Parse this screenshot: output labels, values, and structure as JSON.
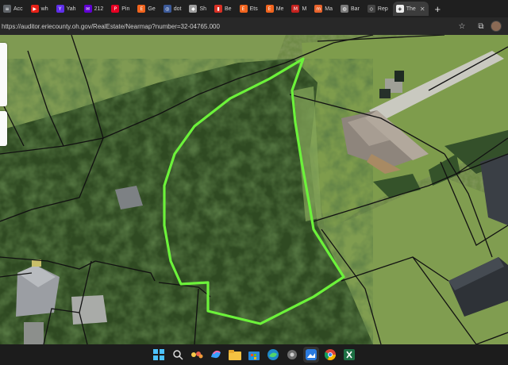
{
  "browser": {
    "tabs": [
      {
        "label": "Acc",
        "icon": "document-icon",
        "color": "#5f6368"
      },
      {
        "label": "wh",
        "icon": "youtube-icon",
        "color": "#e62117"
      },
      {
        "label": "Yah",
        "icon": "yahoo-icon",
        "color": "#5f2eea"
      },
      {
        "label": "212",
        "icon": "yahoo-mail-icon",
        "color": "#6001d2"
      },
      {
        "label": "Pin",
        "icon": "pinterest-icon",
        "color": "#e60023"
      },
      {
        "label": "Ge",
        "icon": "etsy-icon",
        "color": "#f1641e"
      },
      {
        "label": "dot",
        "icon": "circle-logo-icon",
        "color": "#3b5998"
      },
      {
        "label": "Sh",
        "icon": "shopping-icon",
        "color": "#9e9e9e"
      },
      {
        "label": "Be",
        "icon": "bookmark-icon",
        "color": "#d93025"
      },
      {
        "label": "Ets",
        "icon": "etsy-icon",
        "color": "#f1641e"
      },
      {
        "label": "Me",
        "icon": "etsy-icon",
        "color": "#f1641e"
      },
      {
        "label": "M",
        "icon": "mail-icon",
        "color": "#c5221f"
      },
      {
        "label": "Ma",
        "icon": "mercari-icon",
        "color": "#e8632c"
      },
      {
        "label": "Bar",
        "icon": "globe-icon",
        "color": "#7a7a7a"
      },
      {
        "label": "Rep",
        "icon": "diamond-icon",
        "color": "#444444"
      },
      {
        "label": "The",
        "icon": "shield-icon",
        "color": "#eeeeee",
        "active": true
      }
    ],
    "tab_close_glyph": "✕",
    "new_tab_glyph": "+",
    "url": "https://auditor.eriecounty.oh.gov/RealEstate/Nearmap?number=32-04765.000",
    "bookmark_glyph": "☆",
    "extensions_glyph": "⧉"
  },
  "map": {
    "parcel_outline_color": "#6cf23a",
    "parcel_line_color": "#111111"
  },
  "taskbar": {
    "icons": [
      {
        "name": "windows-start-icon"
      },
      {
        "name": "search-icon"
      },
      {
        "name": "widgets-icon"
      },
      {
        "name": "copilot-icon"
      },
      {
        "name": "file-explorer-icon"
      },
      {
        "name": "microsoft-store-icon"
      },
      {
        "name": "edge-icon"
      },
      {
        "name": "settings-icon"
      },
      {
        "name": "photos-icon"
      },
      {
        "name": "chrome-icon"
      },
      {
        "name": "excel-icon"
      }
    ]
  }
}
